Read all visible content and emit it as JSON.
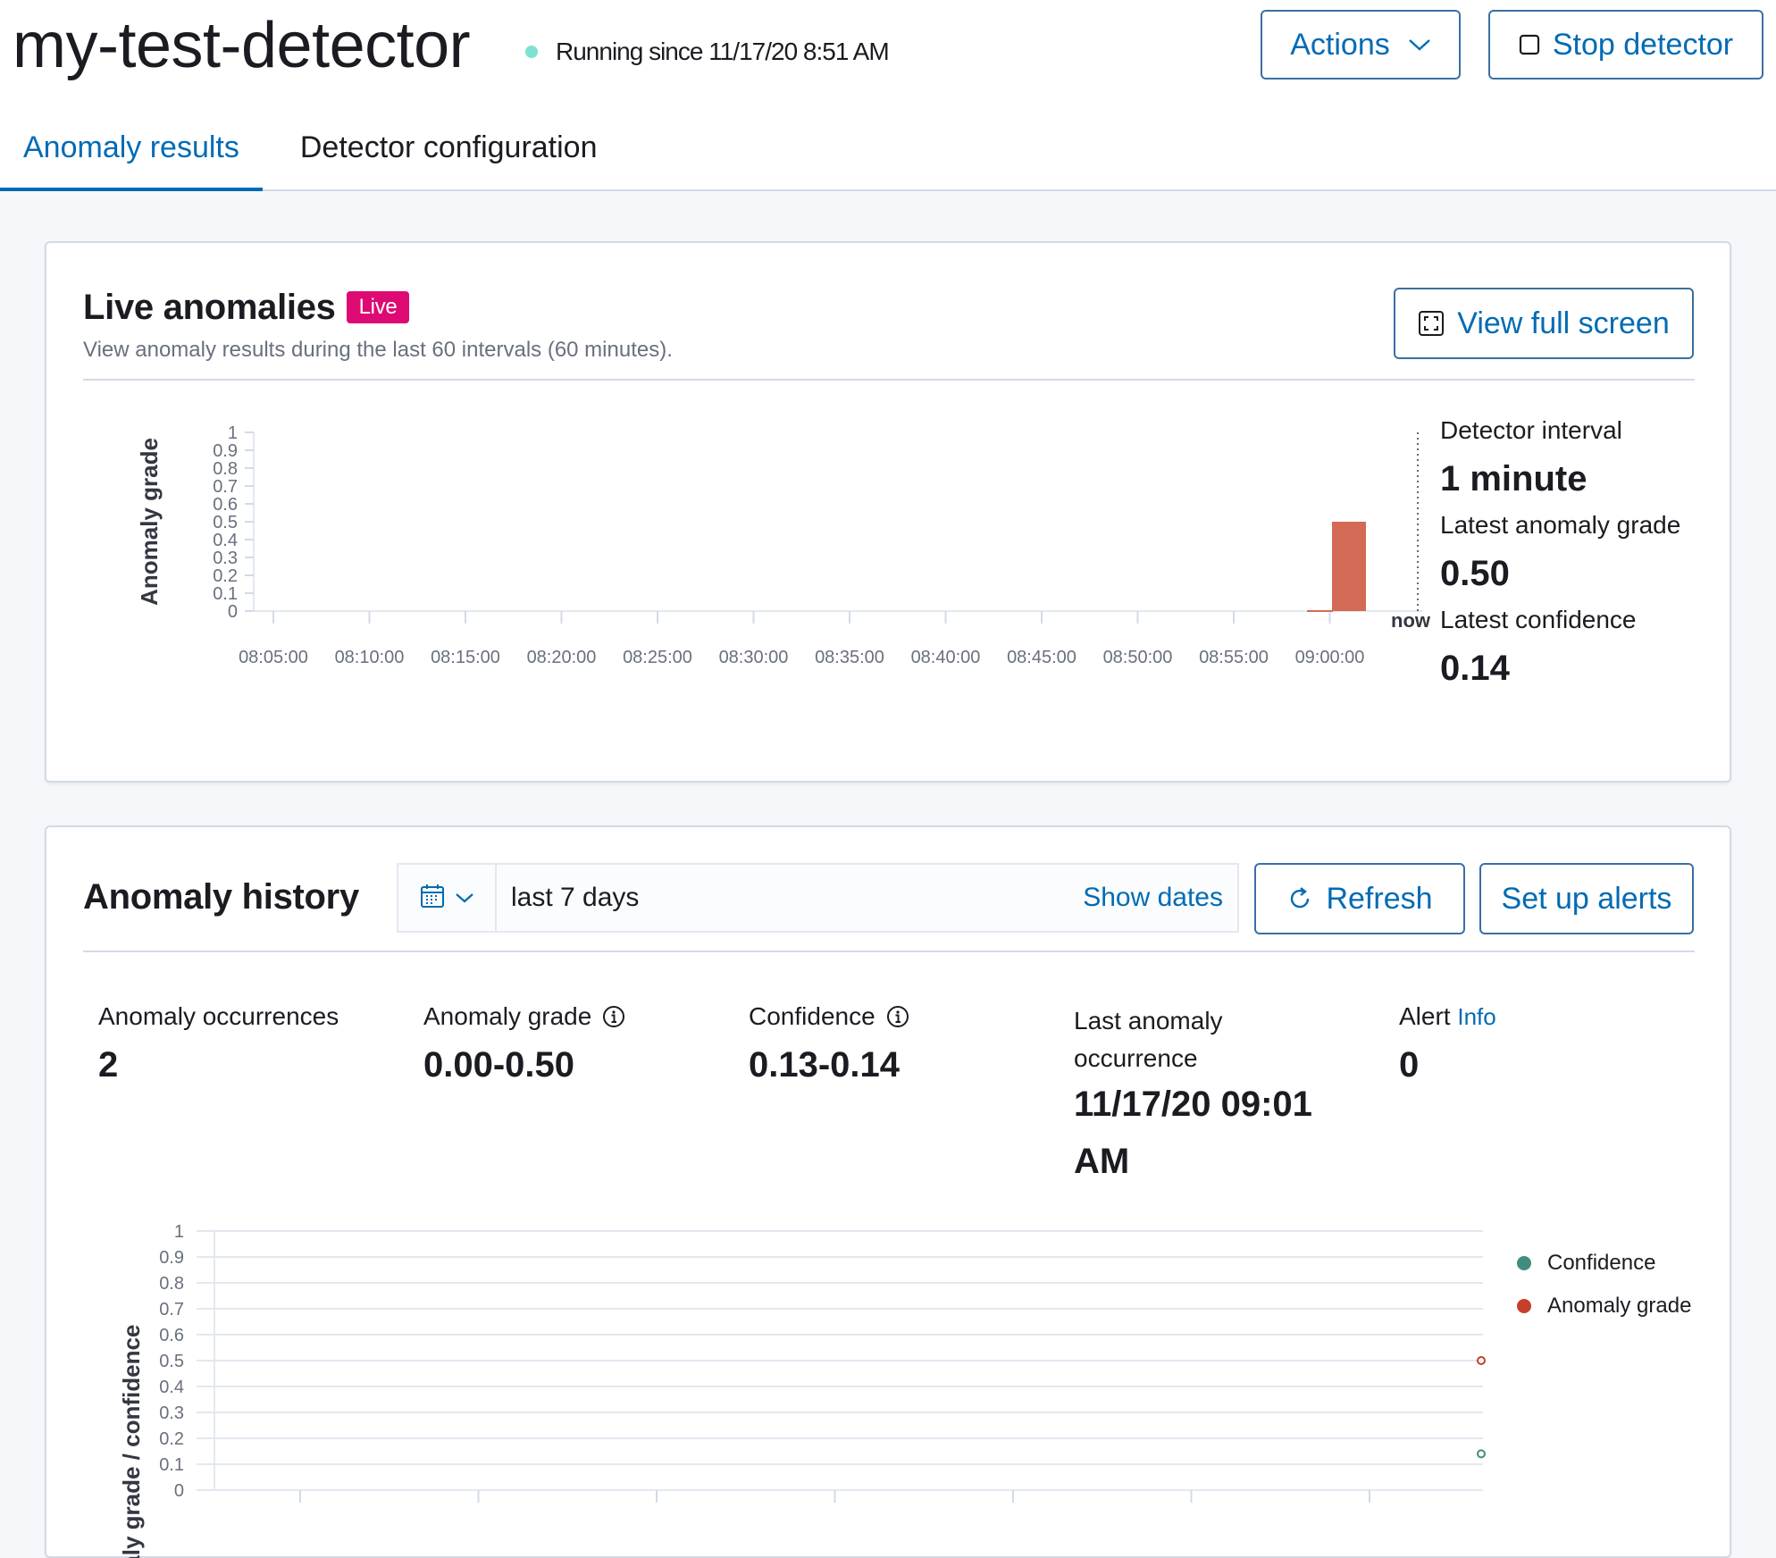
{
  "header": {
    "title": "my-test-detector",
    "status_text": "Running since 11/17/20 8:51 AM",
    "actions_label": "Actions",
    "stop_label": "Stop detector"
  },
  "tabs": [
    {
      "label": "Anomaly results",
      "active": true
    },
    {
      "label": "Detector configuration",
      "active": false
    }
  ],
  "live": {
    "title": "Live anomalies",
    "badge": "Live",
    "subtitle": "View anomaly results during the last 60 intervals (60 minutes).",
    "fullscreen_label": "View full screen",
    "stats": [
      {
        "label": "Detector interval",
        "value": "1 minute"
      },
      {
        "label": "Latest anomaly grade",
        "value": "0.50"
      },
      {
        "label": "Latest confidence",
        "value": "0.14"
      }
    ]
  },
  "history": {
    "title": "Anomaly history",
    "date_range": "last 7 days",
    "show_dates": "Show dates",
    "refresh_label": "Refresh",
    "alerts_label": "Set up alerts",
    "stats": [
      {
        "label": "Anomaly occurrences",
        "value": "2"
      },
      {
        "label": "Anomaly grade",
        "value": "0.00-0.50"
      },
      {
        "label": "Confidence",
        "value": "0.13-0.14"
      },
      {
        "label": "Last anomaly occurrence",
        "value": "11/17/20 09:01 AM"
      },
      {
        "label": "Alert",
        "value": "0",
        "link": "Info"
      }
    ]
  },
  "colors": {
    "accent": "#006bb4",
    "live_badge": "#dd0a73",
    "anomaly_bar": "#d36a55",
    "confidence": "#3f8e7d",
    "anomaly_grade": "#c4402a",
    "running_dot": "#7de2d1"
  },
  "icons": {
    "actions": "chevron-down-icon",
    "stop": "stop-square-icon",
    "fullscreen": "fullscreen-icon",
    "calendar": "calendar-icon",
    "refresh": "refresh-icon",
    "info": "info-circle-icon"
  },
  "chart_data": [
    {
      "type": "bar",
      "ylabel": "Anomaly grade",
      "ylim": [
        0,
        1
      ],
      "yticks": [
        "1",
        "0.9",
        "0.8",
        "0.7",
        "0.6",
        "0.5",
        "0.4",
        "0.3",
        "0.2",
        "0.1",
        "0"
      ],
      "categories": [
        "08:05:00",
        "08:10:00",
        "08:15:00",
        "08:20:00",
        "08:25:00",
        "08:30:00",
        "08:35:00",
        "08:40:00",
        "08:45:00",
        "08:50:00",
        "08:55:00",
        "09:00:00"
      ],
      "marker_label": "now",
      "bars": [
        {
          "x": "09:01:00",
          "value": 0.5
        }
      ]
    },
    {
      "type": "scatter",
      "ylabel": "Anomaly grade / confidence",
      "ylim": [
        0,
        1
      ],
      "yticks": [
        "1",
        "0.9",
        "0.8",
        "0.7",
        "0.6",
        "0.5",
        "0.4",
        "0.3",
        "0.2",
        "0.1",
        "0"
      ],
      "grid": true,
      "legend_position": "right",
      "series": [
        {
          "name": "Confidence",
          "values": [
            0.14
          ]
        },
        {
          "name": "Anomaly grade",
          "values": [
            0.5
          ]
        }
      ]
    }
  ]
}
